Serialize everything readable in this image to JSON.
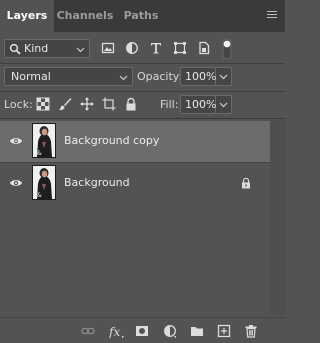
{
  "tabs": [
    {
      "label": "Layers",
      "active": true
    },
    {
      "label": "Channels",
      "active": false
    },
    {
      "label": "Paths",
      "active": false
    }
  ],
  "filter": {
    "kind_label": "Kind",
    "icons": [
      "image-filter-icon",
      "adjustment-filter-icon",
      "type-filter-icon",
      "shape-filter-icon",
      "smart-object-filter-icon",
      "filter-toggle-icon"
    ]
  },
  "blend": {
    "mode": "Normal",
    "opacity_label": "Opacity:",
    "opacity_value": "100%"
  },
  "lock": {
    "label": "Lock:",
    "icons": [
      "lock-transparent-pixels-icon",
      "lock-image-pixels-icon",
      "lock-position-icon",
      "lock-artboard-icon",
      "lock-all-icon"
    ],
    "fill_label": "Fill:",
    "fill_value": "100%"
  },
  "layers": [
    {
      "name": "Background copy",
      "visible": true,
      "selected": true,
      "locked": false
    },
    {
      "name": "Background",
      "visible": true,
      "selected": false,
      "locked": true
    }
  ],
  "bottom_icons": [
    "link-layers-icon",
    "fx-icon",
    "layer-mask-icon",
    "adjustment-layer-icon",
    "group-folder-icon",
    "new-layer-icon",
    "trash-icon"
  ],
  "colors": {
    "panel_bg": "#535353",
    "tab_bar_bg": "#3a3a3a",
    "selected_row": "#6c6c6c"
  }
}
